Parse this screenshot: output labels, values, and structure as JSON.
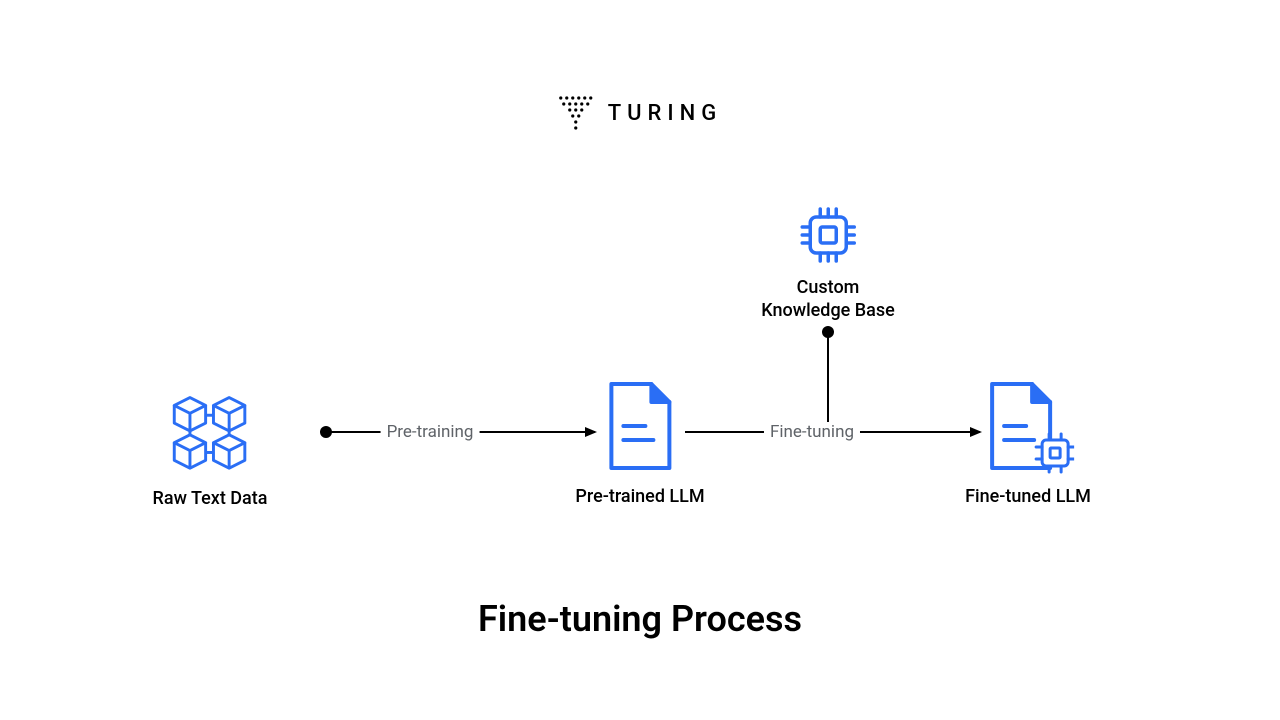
{
  "brand": {
    "name": "TURING"
  },
  "diagram": {
    "title": "Fine-tuning Process",
    "nodes": {
      "raw": {
        "label": "Raw Text Data"
      },
      "pretrained": {
        "label": "Pre-trained LLM"
      },
      "finetuned": {
        "label": "Fine-tuned LLM"
      },
      "custom": {
        "label_line1": "Custom",
        "label_line2": "Knowledge Base"
      }
    },
    "edges": {
      "pretraining": {
        "label": "Pre-training"
      },
      "finetuning": {
        "label": "Fine-tuning"
      }
    },
    "colors": {
      "accent": "#2A6EF5",
      "text": "#000000"
    }
  }
}
